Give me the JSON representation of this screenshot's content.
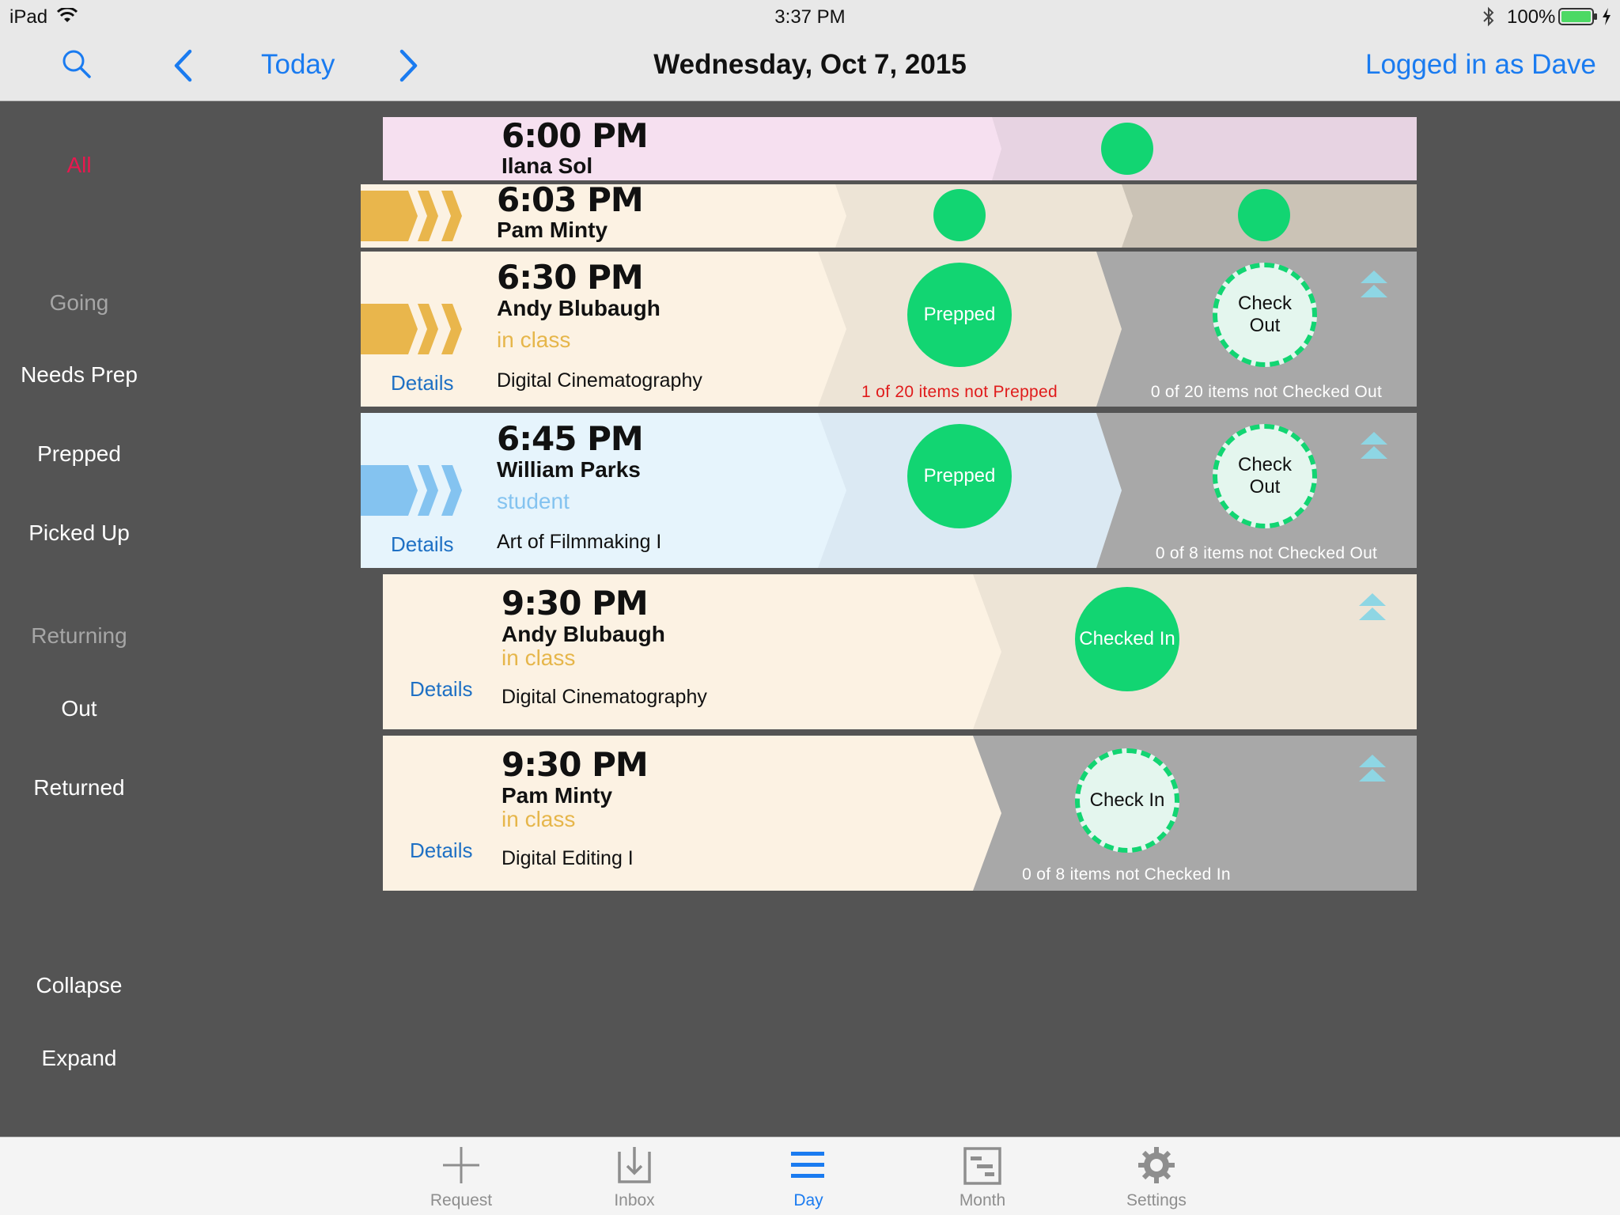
{
  "status_bar": {
    "device": "iPad",
    "time": "3:37 PM",
    "battery": "100%",
    "icons": [
      "wifi-icon",
      "bluetooth-icon",
      "battery-icon",
      "charging-icon"
    ]
  },
  "nav": {
    "today_label": "Today",
    "title": "Wednesday, Oct 7, 2015",
    "login_label": "Logged in as Dave"
  },
  "sidebar": {
    "all": "All",
    "going_heading": "Going",
    "needs_prep": "Needs Prep",
    "prepped": "Prepped",
    "picked_up": "Picked Up",
    "returning_heading": "Returning",
    "out": "Out",
    "returned": "Returned",
    "collapse": "Collapse",
    "expand": "Expand"
  },
  "rows": [
    {
      "time": "6:00 PM",
      "name": "Ilana Sol"
    },
    {
      "time": "6:03 PM",
      "name": "Pam Minty"
    },
    {
      "time": "6:30 PM",
      "name": "Andy Blubaugh",
      "role": "in class",
      "details": "Details",
      "course": "Digital Cinematography",
      "status1": "Prepped",
      "note1": "1 of 20 items not Prepped",
      "status2_line1": "Check",
      "status2_line2": "Out",
      "note2": "0 of 20 items not Checked Out"
    },
    {
      "time": "6:45 PM",
      "name": "William Parks",
      "role": "student",
      "details": "Details",
      "course": "Art of Filmmaking I",
      "status1": "Prepped",
      "status2_line1": "Check",
      "status2_line2": "Out",
      "note2": "0 of 8 items not Checked Out"
    },
    {
      "time": "9:30 PM",
      "name": "Andy Blubaugh",
      "role": "in class",
      "details": "Details",
      "course": "Digital Cinematography",
      "status1": "Checked In"
    },
    {
      "time": "9:30 PM",
      "name": "Pam Minty",
      "role": "in class",
      "details": "Details",
      "course": "Digital Editing I",
      "status1": "Check In",
      "note1": "0 of 8 items not Checked In"
    }
  ],
  "colors": {
    "accent": "#1a7bf0",
    "status_green": "#12d572",
    "alert_red": "#e01b1b",
    "class_orange": "#e6b64a",
    "student_blue": "#84c3f0"
  },
  "tabs": [
    {
      "label": "Request",
      "icon": "plus-icon"
    },
    {
      "label": "Inbox",
      "icon": "inbox-icon"
    },
    {
      "label": "Day",
      "icon": "list-icon"
    },
    {
      "label": "Month",
      "icon": "calendar-icon"
    },
    {
      "label": "Settings",
      "icon": "gear-icon"
    }
  ]
}
